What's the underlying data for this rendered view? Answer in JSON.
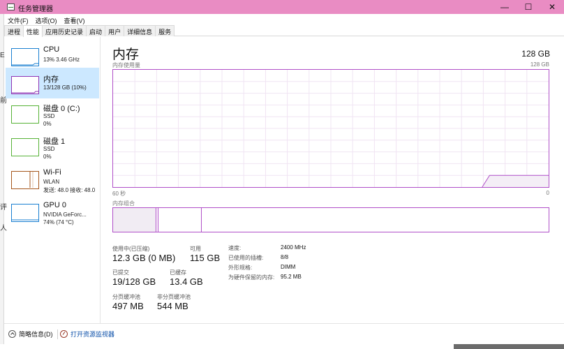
{
  "window": {
    "title": "任务管理器",
    "minimize": "—",
    "maximize": "☐",
    "close": "✕"
  },
  "menu": [
    "文件(F)",
    "选项(O)",
    "查看(V)"
  ],
  "tabs": [
    "进程",
    "性能",
    "应用历史记录",
    "启动",
    "用户",
    "详细信息",
    "服务"
  ],
  "active_tab": "性能",
  "edge_glyphs": [
    "E",
    "前",
    "评",
    "人"
  ],
  "sidebar": {
    "items": [
      {
        "name": "CPU",
        "sub1": "13% 3.46 GHz",
        "sub2": "",
        "color": "#1a7fd1"
      },
      {
        "name": "内存",
        "sub1": "13/128 GB (10%)",
        "sub2": "",
        "color": "#8e35b4",
        "active": true
      },
      {
        "name": "磁盘 0 (C:)",
        "sub1": "SSD",
        "sub2": "0%",
        "color": "#56b236"
      },
      {
        "name": "磁盘 1",
        "sub1": "SSD",
        "sub2": "0%",
        "color": "#56b236"
      },
      {
        "name": "Wi-Fi",
        "sub1": "WLAN",
        "sub2": "发送: 48.0  接收: 48.0",
        "color": "#a5561b"
      },
      {
        "name": "GPU 0",
        "sub1": "NVIDIA GeForc...",
        "sub2": "74% (74 °C)",
        "color": "#1a7fd1"
      }
    ]
  },
  "main": {
    "title": "内存",
    "total": "128 GB",
    "graph_label": "内存使用量",
    "graph_max": "128 GB",
    "axis_left": "60 秒",
    "axis_right": "0",
    "composition_label": "内存组合",
    "graph_series_fraction": [
      0,
      0,
      0,
      0,
      0,
      0,
      0,
      0,
      0,
      0,
      0,
      0,
      0,
      0,
      0,
      0,
      0,
      0,
      0,
      0,
      0,
      0,
      0,
      0,
      0,
      0,
      0,
      0,
      0,
      0,
      0,
      0,
      0,
      0,
      0,
      0,
      0,
      0,
      0,
      0,
      0,
      0,
      0,
      0,
      0,
      0,
      0,
      0,
      0,
      0,
      0,
      0.1,
      0.1,
      0.1,
      0.1,
      0.1,
      0.1,
      0.1,
      0.1,
      0.1
    ],
    "graph_color": "#b04fc8",
    "stats": {
      "in_use_label": "使用中(已压缩)",
      "in_use_value": "12.3 GB (0 MB)",
      "available_label": "可用",
      "available_value": "115 GB",
      "committed_label": "已提交",
      "committed_value": "19/128 GB",
      "cached_label": "已缓存",
      "cached_value": "13.4 GB",
      "paged_label": "分页缓冲池",
      "paged_value": "497 MB",
      "nonpaged_label": "非分页缓冲池",
      "nonpaged_value": "544 MB"
    },
    "details": [
      {
        "label": "速度:",
        "value": "2400 MHz"
      },
      {
        "label": "已使用的插槽:",
        "value": "8/8"
      },
      {
        "label": "外形规格:",
        "value": "DIMM"
      },
      {
        "label": "为硬件保留的内存:",
        "value": "95.2 MB"
      }
    ]
  },
  "footer": {
    "fewer_details": "简略信息(D)",
    "open_monitor": "打开资源监视器"
  }
}
